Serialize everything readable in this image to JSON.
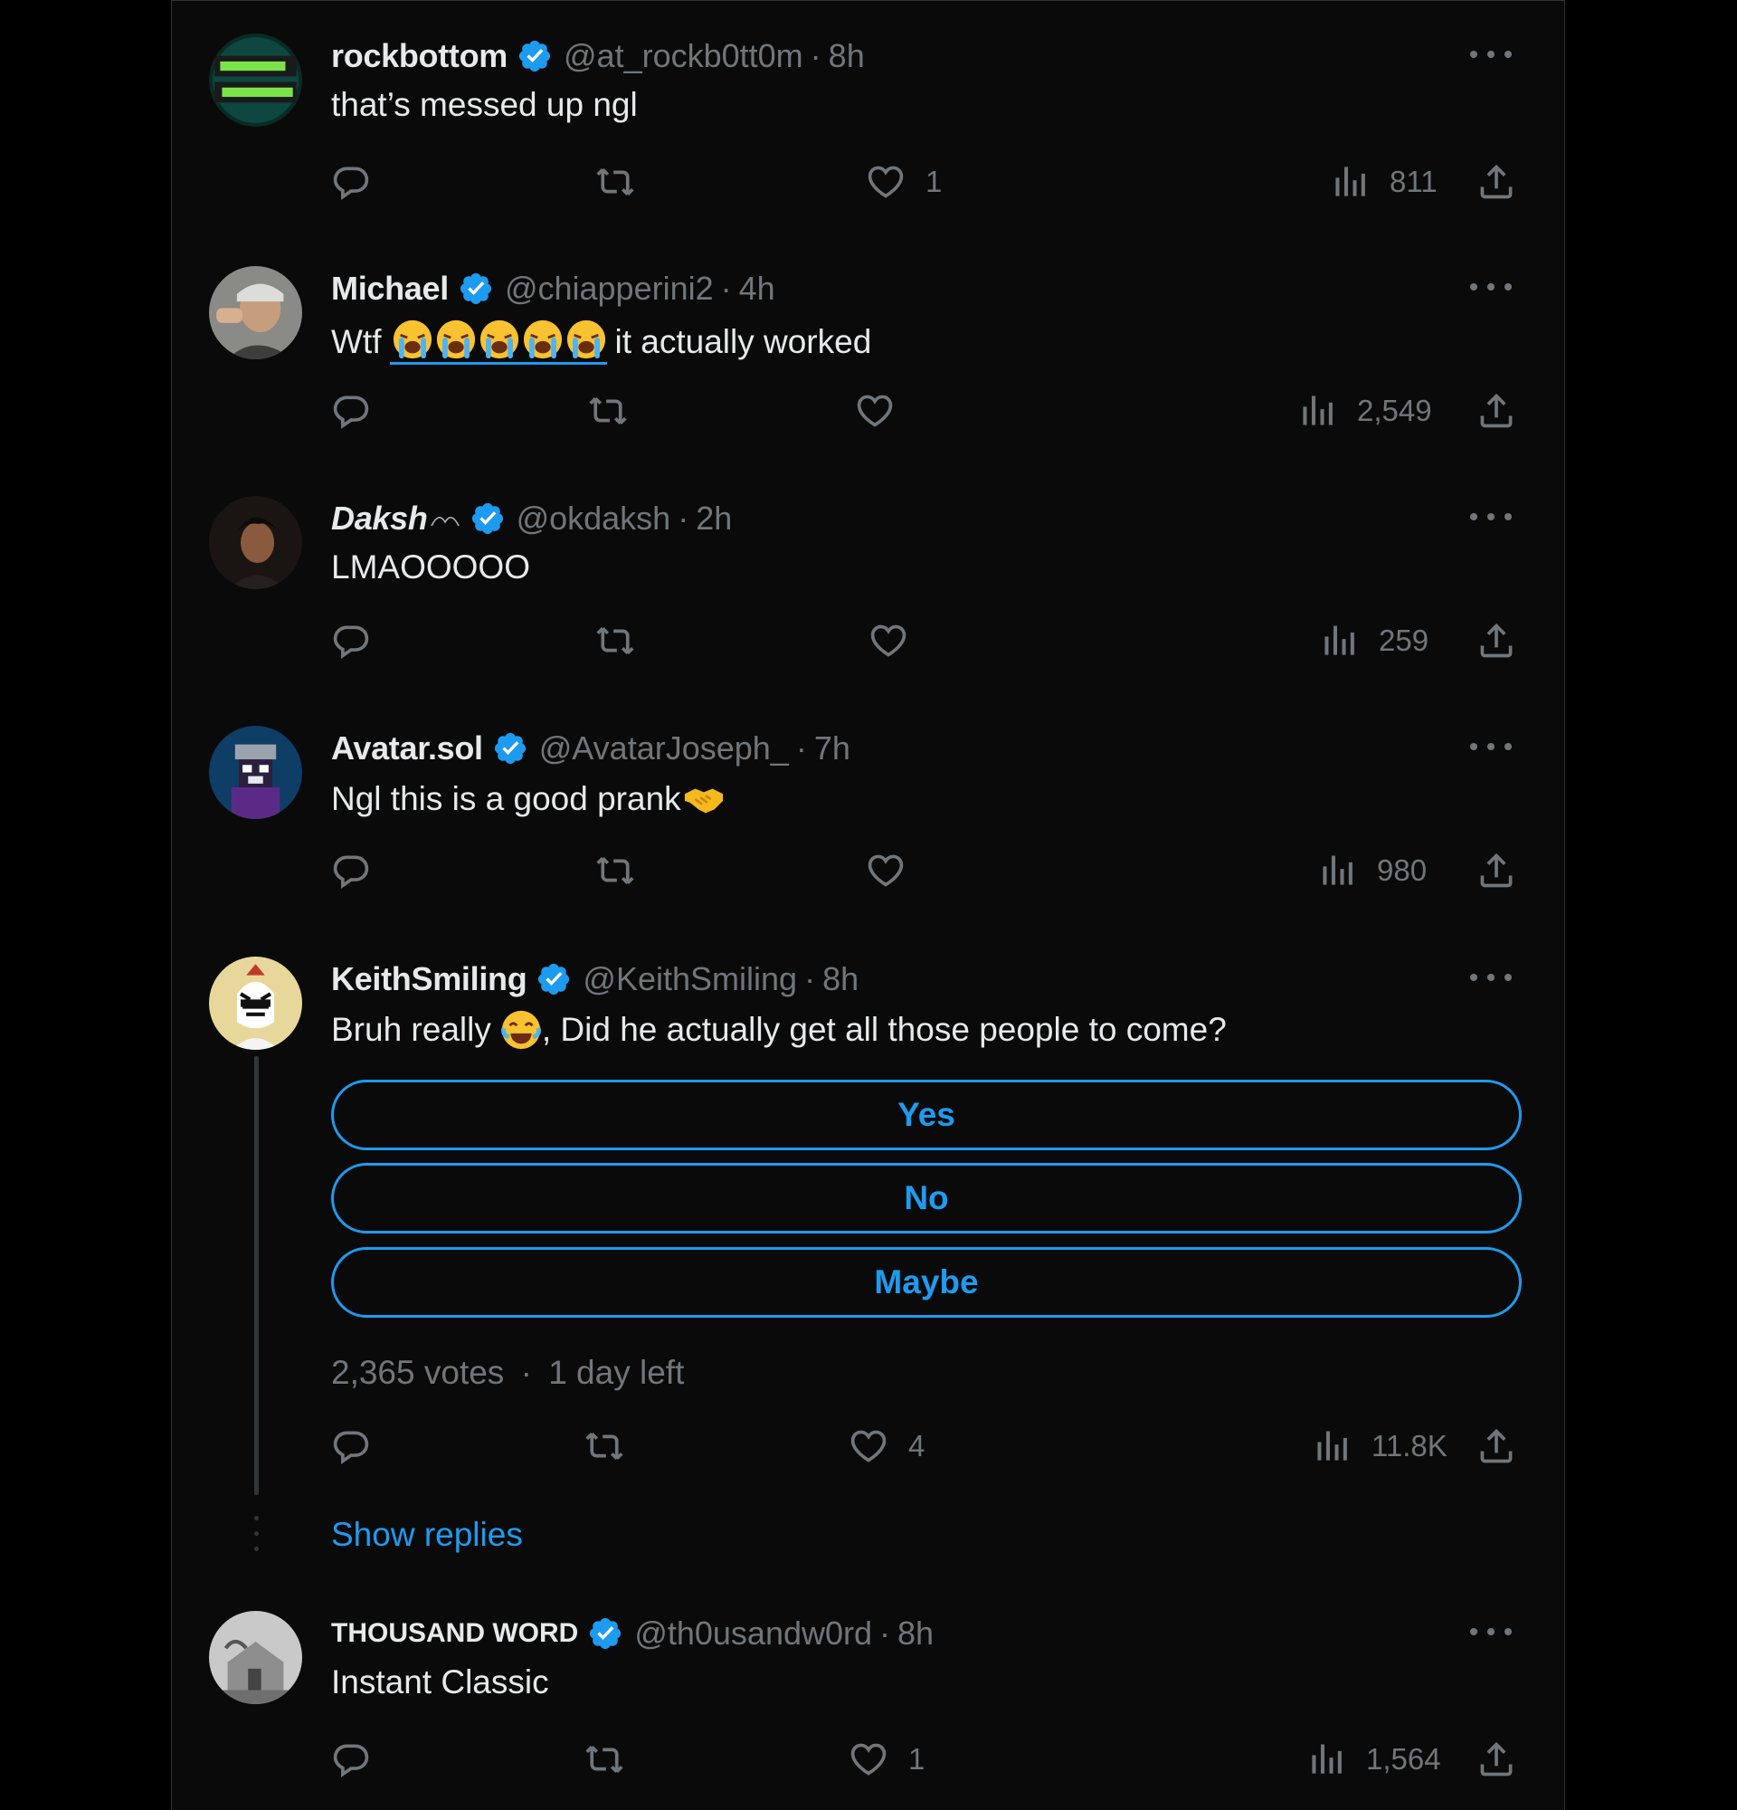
{
  "colors": {
    "background": "#000000",
    "surface": "#0a0a0a",
    "accent": "#1d9bf0",
    "muted": "#71767b",
    "text": "#e7e9ea",
    "divider": "#2f3336"
  },
  "tweets": [
    {
      "name": "rockbottom",
      "handle": "@at_rockb0tt0m",
      "sep": "·",
      "time": "8h",
      "text": "that’s messed up ngl",
      "likes": "1",
      "views": "811",
      "avatar_icon": "rock-bottom-logo-avatar"
    },
    {
      "name": "Michael",
      "handle": "@chiapperini2",
      "sep": "·",
      "time": "4h",
      "text_before": "Wtf",
      "emoji_name": "loudly-crying-face-emoji",
      "text_after": "it actually worked",
      "likes": "",
      "views": "2,549",
      "avatar_icon": "person-photo-avatar"
    },
    {
      "name": "Daksh",
      "handle": "@okdaksh",
      "sep": "·",
      "time": "2h",
      "text": "LMAOOOOO",
      "likes": "",
      "views": "259",
      "avatar_icon": "person-photo-avatar"
    },
    {
      "name": "Avatar.sol",
      "handle": "@AvatarJoseph_",
      "sep": "·",
      "time": "7h",
      "text": "Ngl this is a good prank",
      "emoji_name": "handshake-emoji",
      "likes": "",
      "views": "980",
      "avatar_icon": "pixel-art-avatar"
    },
    {
      "name": "KeithSmiling",
      "handle": "@KeithSmiling",
      "sep": "·",
      "time": "8h",
      "text_before": "Bruh really",
      "emoji_name": "tears-of-joy-emoji",
      "text_after": ", Did he actually get all those people to come?",
      "poll_options": [
        "Yes",
        "No",
        "Maybe"
      ],
      "poll_votes": "2,365 votes",
      "poll_sep": "·",
      "poll_time_left": "1 day left",
      "likes": "4",
      "views": "11.8K",
      "show_replies": "Show replies",
      "avatar_icon": "zebra-cartoon-avatar"
    },
    {
      "name": "THOUSAND WORD",
      "handle": "@th0usandw0rd",
      "sep": "·",
      "time": "8h",
      "text": "Instant Classic",
      "likes": "1",
      "views": "1,564",
      "avatar_icon": "house-photo-avatar"
    }
  ]
}
